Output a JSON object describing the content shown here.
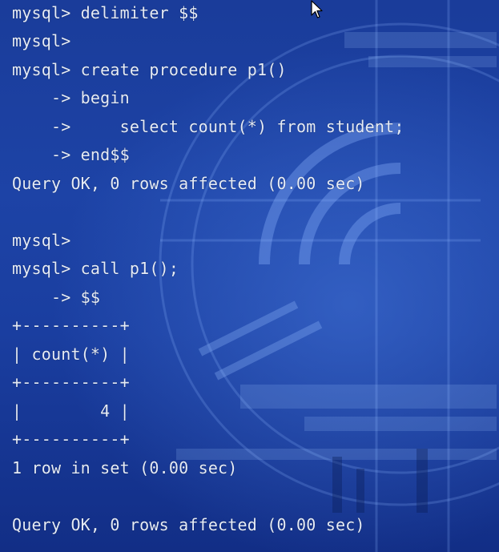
{
  "terminal": {
    "lines": [
      "mysql> delimiter $$",
      "mysql>",
      "mysql> create procedure p1()",
      "    -> begin",
      "    ->     select count(*) from student;",
      "    -> end$$",
      "Query OK, 0 rows affected (0.00 sec)",
      "",
      "mysql>",
      "mysql> call p1();",
      "    -> $$",
      "+----------+",
      "| count(*) |",
      "+----------+",
      "|        4 |",
      "+----------+",
      "1 row in set (0.00 sec)",
      "",
      "Query OK, 0 rows affected (0.00 sec)"
    ]
  },
  "icons": {
    "cursor": "mouse-pointer-icon"
  },
  "colors": {
    "background": "#1d43a6",
    "text": "#e6ecf7"
  }
}
